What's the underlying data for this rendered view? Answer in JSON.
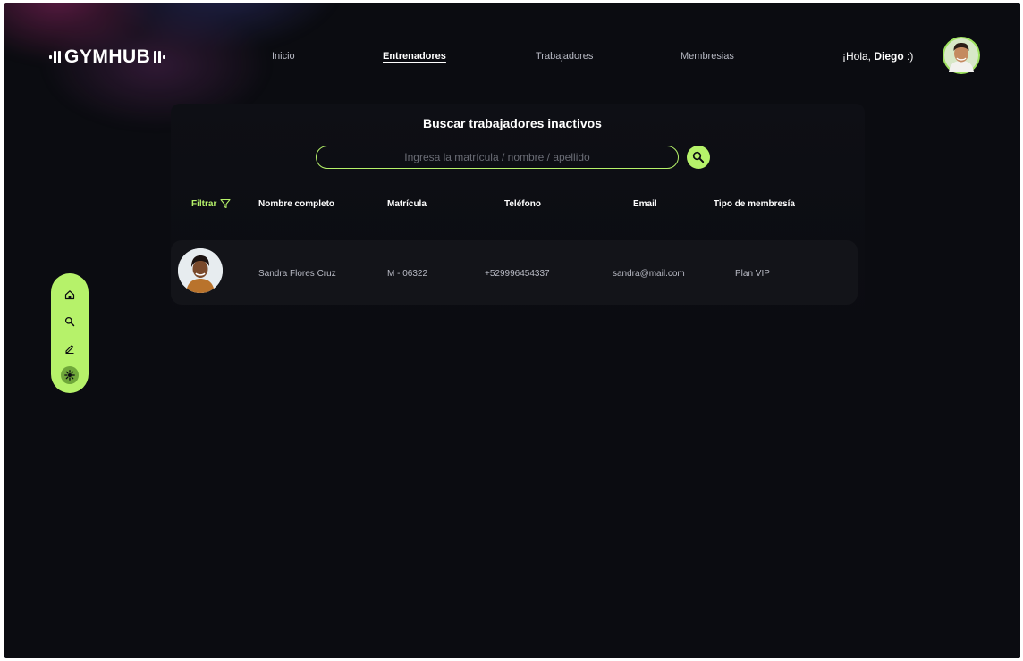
{
  "brand": {
    "logo_text": "GYMHUB"
  },
  "nav": {
    "items": [
      {
        "label": "Inicio"
      },
      {
        "label": "Entrenadores"
      },
      {
        "label": "Trabajadores"
      },
      {
        "label": "Membresias"
      }
    ],
    "active": "Entrenadores"
  },
  "user": {
    "greeting": "¡Hola, ",
    "name": "Diego",
    "suffix": " :)"
  },
  "main": {
    "title": "Buscar trabajadores inactivos",
    "search": {
      "placeholder": "Ingresa la matrícula / nombre / apellido",
      "value": ""
    }
  },
  "filter": {
    "label": "Filtrar"
  },
  "table": {
    "columns": [
      "Nombre completo",
      "Matrícula",
      "Teléfono",
      "Email",
      "Tipo de membresía"
    ],
    "rows": [
      {
        "name": "Sandra Flores Cruz",
        "id": "M - 06322",
        "phone": "+529996454337",
        "email": "sandra@mail.com",
        "plan": "Plan VIP"
      }
    ]
  },
  "sidebar": {
    "icons": [
      "home-icon",
      "search-icon",
      "edit-icon",
      "settings-icon"
    ],
    "active": "settings-icon"
  },
  "colors": {
    "accent": "#b6f26a",
    "background": "#0b0c11",
    "row": "#131419"
  }
}
